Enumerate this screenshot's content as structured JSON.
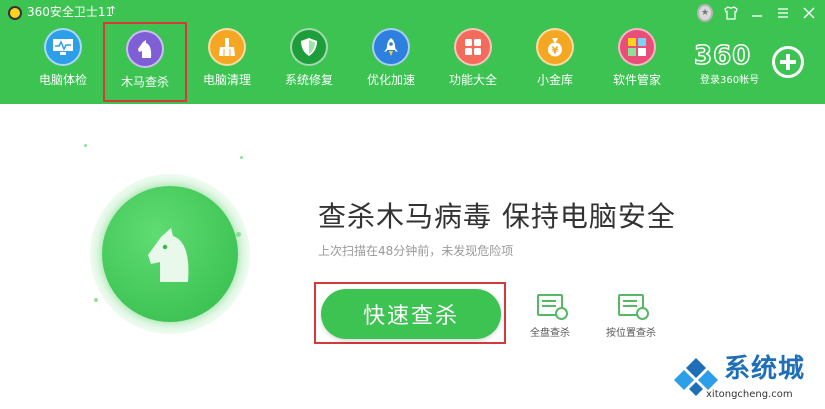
{
  "window": {
    "title": "360安全卫士11",
    "controls": [
      "medal",
      "shirt",
      "minimize",
      "menu",
      "close"
    ]
  },
  "nav": {
    "items": [
      {
        "label": "电脑体检",
        "icon": "monitor-icon",
        "color": "#2d9ee8",
        "active": false
      },
      {
        "label": "木马查杀",
        "icon": "horse-icon",
        "color": "#7e5fd6",
        "active": true
      },
      {
        "label": "电脑清理",
        "icon": "broom-icon",
        "color": "#f5a623",
        "active": false
      },
      {
        "label": "系统修复",
        "icon": "shield-icon",
        "color": "#1e9e3a",
        "active": false
      },
      {
        "label": "优化加速",
        "icon": "rocket-icon",
        "color": "#2d7fe0",
        "active": false
      },
      {
        "label": "功能大全",
        "icon": "grid-icon",
        "color": "#f26b5b",
        "active": false
      },
      {
        "label": "小金库",
        "icon": "moneybag-icon",
        "color": "#f5a623",
        "active": false
      },
      {
        "label": "软件管家",
        "icon": "apps-icon",
        "color": "#e94e77",
        "active": false
      }
    ]
  },
  "account": {
    "logo_text": "360",
    "login_label": "登录360帐号"
  },
  "main": {
    "headline": "查杀木马病毒  保持电脑安全",
    "subtext": "上次扫描在48分钟前，未发现危险项",
    "scan_button": "快速查杀",
    "tools": [
      {
        "label": "全盘查杀",
        "icon": "full-disk-scan-icon"
      },
      {
        "label": "按位置查杀",
        "icon": "location-scan-icon"
      }
    ]
  },
  "watermark": {
    "brand": "系统城",
    "domain": "xitongcheng.com"
  },
  "colors": {
    "header_green": "#3cc352",
    "highlight_red": "#d43a3a",
    "accent_green": "#3cc352"
  }
}
